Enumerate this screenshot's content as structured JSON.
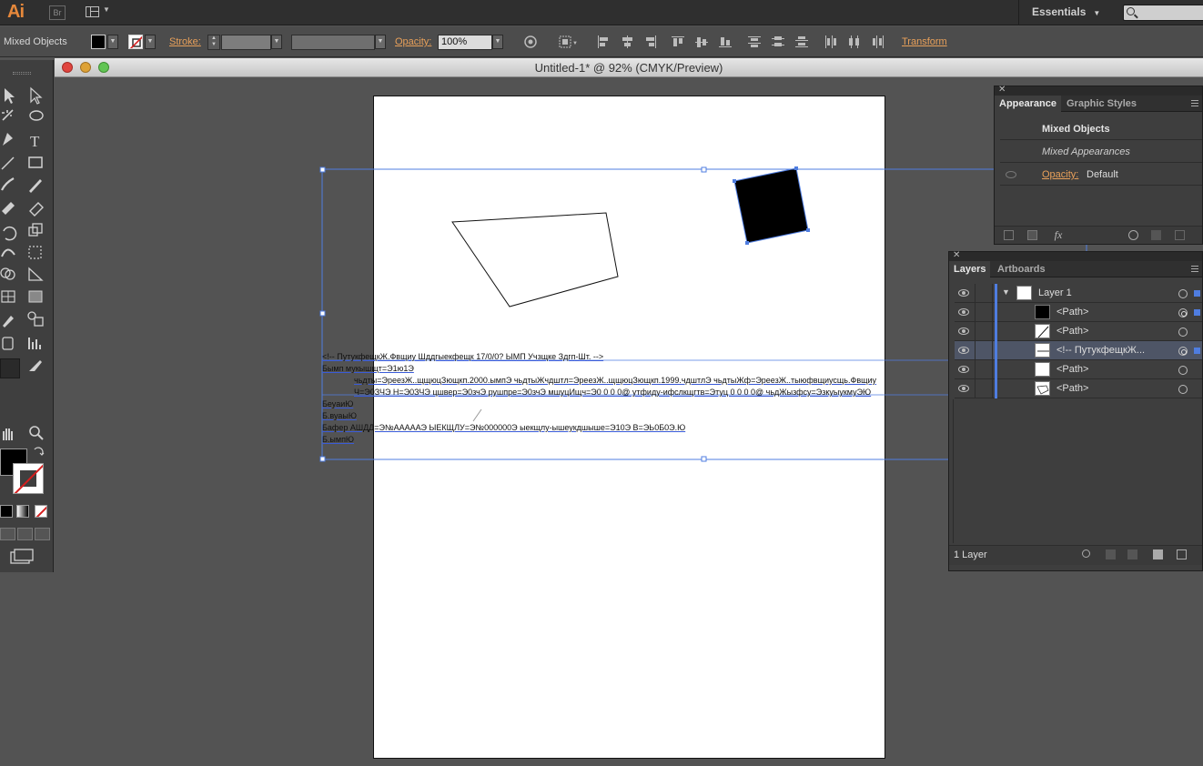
{
  "app": {
    "logo": "Ai",
    "bridge": "Br",
    "workspace": "Essentials"
  },
  "control": {
    "selection_label": "Mixed Objects",
    "stroke_label": "Stroke:",
    "opacity_label": "Opacity:",
    "opacity_value": "100%",
    "transform_label": "Transform"
  },
  "document": {
    "title": "Untitled-1* @ 92% (CMYK/Preview)"
  },
  "artwork": {
    "text_lines": [
      "<!-- ПутукфещкЖ.Фвщиу Шддгыекфещк 17/0/0? ЫМП Учзщке Здгп-Шт. -->",
      "Бымп мукышщт=Э1ю1Э",
      "чьдты=ЭреезЖ..щщюцЗющкп.2000.ымпЭ чьдтыЖчдштл=ЭреезЖ..щщюцЗющкп.1999.чдштлЭ чьдтыЖф=ЭреезЖ..тыюфвщиусщь.Фвщиу",
      "Ч=Э0ЗЧЭ Н=Э0ЗЧЭ цшвер=Э0зчЭ рушпре=Э0зчЭ мшуцИщч=Э0 0 0 0@ утфиду-ифслкщгтв=Этуц 0 0 0 0@ чьдЖызфсу=ЭзкуыукмуЭЮ",
      "БеуаиЮ",
      "Б.вуаыЮ",
      "Бафер АШДД=Э№АААААЭ ЫЕКЩЛУ=Э№000000Э ыекщлу-ышеукдшыше=Э10Э В=ЭЬ0Б0Э.Ю",
      "Б.ымпЮ"
    ]
  },
  "appearance_panel": {
    "tabs": [
      "Appearance",
      "Graphic Styles"
    ],
    "header": "Mixed Objects",
    "subheader": "Mixed Appearances",
    "opacity_label": "Opacity:",
    "opacity_value": "Default",
    "fx_label": "fx"
  },
  "layers_panel": {
    "tabs": [
      "Layers",
      "Artboards"
    ],
    "layer_name": "Layer 1",
    "items": [
      "<Path>",
      "<Path>",
      "<!-- ПутукфещкЖ...",
      "<Path>",
      "<Path>"
    ],
    "footer": "1 Layer"
  },
  "colors": {
    "accent": "#e8a05a",
    "selection": "#4f7de0",
    "workspace_bg": "#535353"
  }
}
